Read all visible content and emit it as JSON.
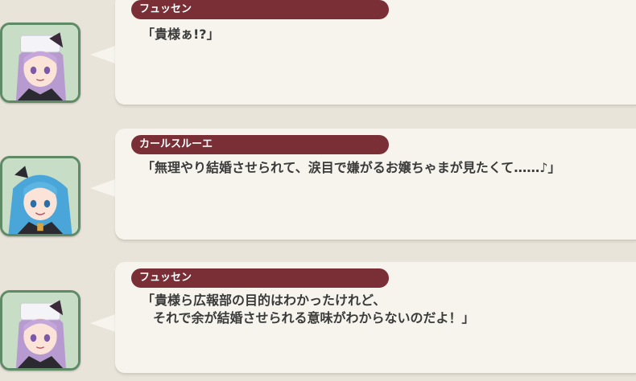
{
  "dialogue": [
    {
      "speaker": "フュッセン",
      "portrait": "lavender-hair-nurse-cap-girl-portrait-icon",
      "lines": [
        "「貴様ぁ!?」"
      ]
    },
    {
      "speaker": "カールスルーエ",
      "portrait": "blue-hair-twintail-girl-portrait-icon",
      "lines": [
        "「無理やり結婚させられて、涙目で嫌がるお嬢ちゃまが見たくて……♪」"
      ]
    },
    {
      "speaker": "フュッセン",
      "portrait": "lavender-hair-nurse-cap-girl-portrait-icon",
      "lines": [
        "「貴様ら広報部の目的はわかったけれど、",
        "それで余が結婚させられる意味がわからないのだよ！」"
      ]
    }
  ],
  "colors": {
    "nameplate": "#7a2f36",
    "bubble": "#f7f4ee",
    "background": "#e9e4da",
    "avatar_frame": "#5e8a65",
    "text": "#3a3a3a"
  }
}
